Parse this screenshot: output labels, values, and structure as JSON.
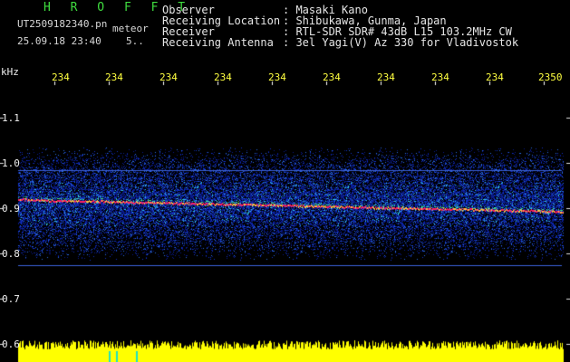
{
  "header": {
    "title": "H R O F F T",
    "filename": "UT2509182340.pn",
    "type_label": "meteor",
    "datetime": "25.09.18 23:40",
    "index": "5..",
    "fields": [
      {
        "label": "Observer",
        "value": ": Masaki Kano"
      },
      {
        "label": "Receiving Location",
        "value": ": Shibukawa, Gunma, Japan"
      },
      {
        "label": "Receiver",
        "value": ": RTL-SDR SDR# 43dB L15 103.2MHz CW"
      },
      {
        "label": "Receiving Antenna",
        "value": ": 3el Yagi(V) Az 330 for Vladivostok"
      }
    ]
  },
  "time_axis": {
    "labels": [
      "234",
      "234",
      "234",
      "234",
      "234",
      "234",
      "234",
      "234",
      "234",
      "2350"
    ]
  },
  "freq_axis": {
    "unit": "kHz",
    "labels": [
      "1.1",
      "1.0",
      "0.9",
      "0.8",
      "0.7",
      "0.6"
    ]
  },
  "colors": {
    "background": "#000000",
    "title": "#3fdc3f",
    "tick": "#ffff40",
    "power": "#ffff00",
    "signal": "#ff2060"
  }
}
